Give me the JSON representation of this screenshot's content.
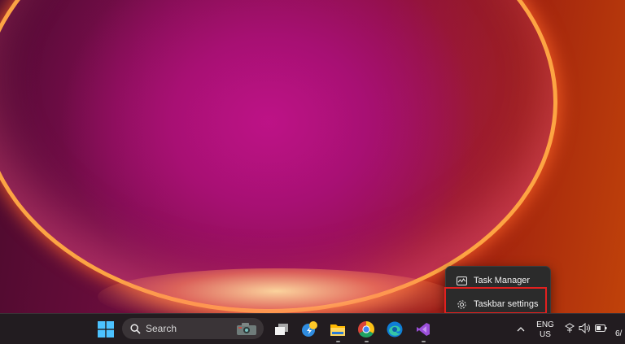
{
  "context_menu": {
    "items": [
      {
        "label": "Task Manager",
        "icon": "task-manager-icon"
      },
      {
        "label": "Taskbar settings",
        "icon": "gear-icon"
      }
    ]
  },
  "taskbar": {
    "search": {
      "placeholder": "Search"
    },
    "apps": [
      "start",
      "search",
      "task-view",
      "widgets",
      "file-explorer",
      "chrome",
      "edge",
      "visual-studio"
    ],
    "language": {
      "top": "ENG",
      "bottom": "US"
    },
    "clock_partial": "6/"
  },
  "colors": {
    "highlight": "#e2201f",
    "menu_bg": "#2b2b2b",
    "taskbar_bg": "#221c20"
  }
}
